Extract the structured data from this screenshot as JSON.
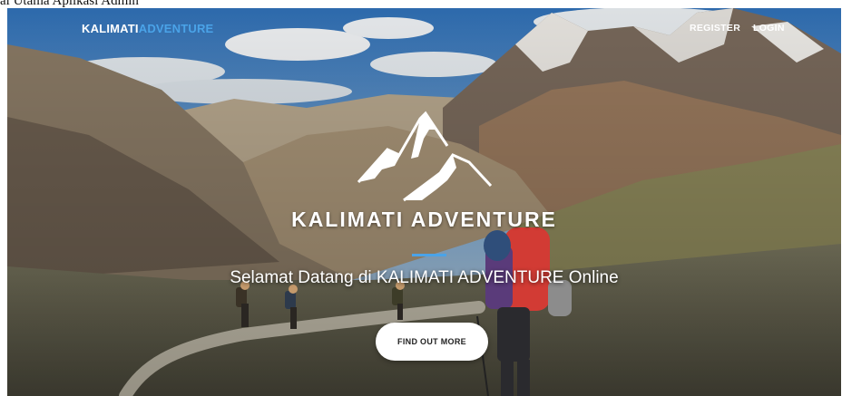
{
  "window": {
    "caption": "ai Utama Aplikasi Admin"
  },
  "navbar": {
    "brand_primary": "KALIMATI",
    "brand_secondary": "ADVENTURE",
    "register_label": "REGISTER",
    "login_label": "LOGIN"
  },
  "hero": {
    "logo_text": "KALIMATI  ADVENTURE",
    "welcome_text": "Selamat Datang di KALIMATI ADVENTURE Online",
    "cta_label": "FIND OUT MORE"
  },
  "colors": {
    "accent": "#4aa3e8",
    "text_light": "#ffffff",
    "button_bg": "#ffffff"
  }
}
